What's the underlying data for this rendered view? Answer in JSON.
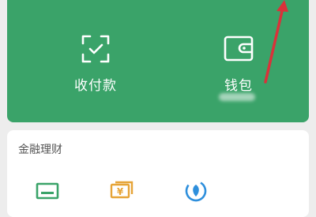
{
  "main_actions": {
    "pay": {
      "label": "收付款",
      "icon": "qr-scan-icon"
    },
    "wallet": {
      "label": "钱包",
      "icon": "wallet-icon"
    }
  },
  "finance": {
    "title": "金融理财",
    "icons": [
      "credit-card-icon",
      "money-icon",
      "wealth-icon"
    ]
  },
  "colors": {
    "green": "#3aa369",
    "arrow": "#d9323a"
  }
}
